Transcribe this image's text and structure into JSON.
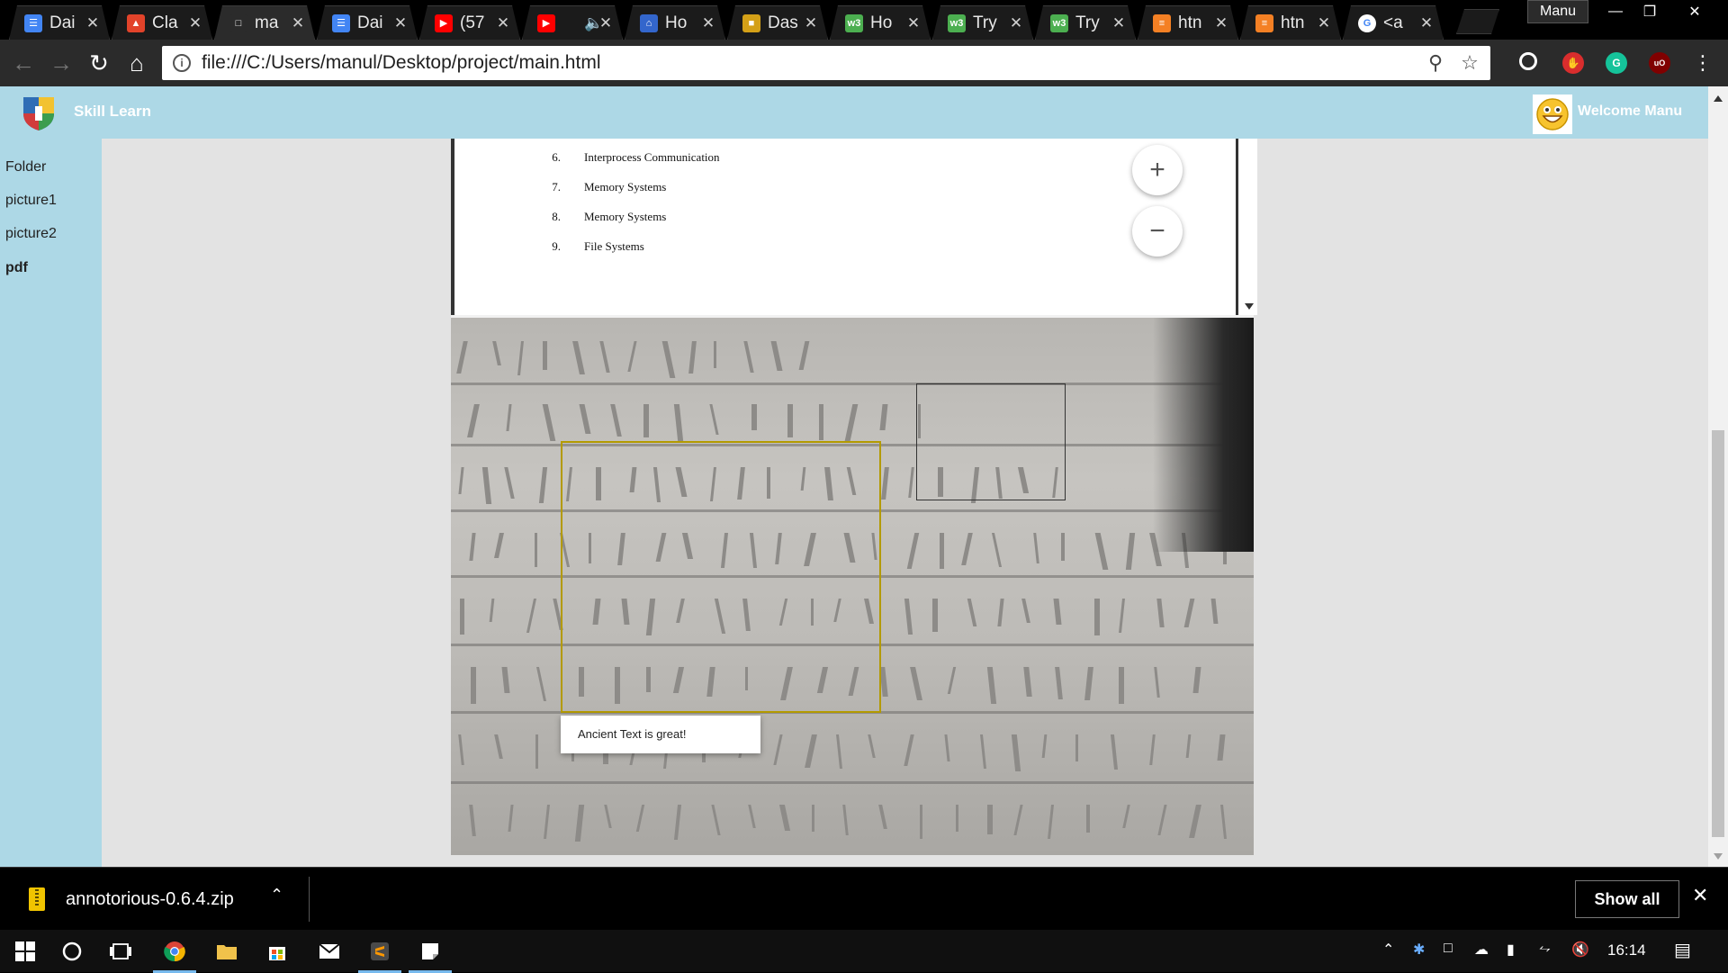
{
  "browser": {
    "tabs": [
      {
        "title": "Dai",
        "favicon": "docs-icon",
        "color": "#4285f4"
      },
      {
        "title": "Cla",
        "favicon": "gitlab-icon",
        "color": "#e2432a"
      },
      {
        "title": "ma",
        "favicon": "page-icon",
        "color": "#2b2b2b",
        "active": true
      },
      {
        "title": "Dai",
        "favicon": "docs-icon",
        "color": "#4285f4"
      },
      {
        "title": "(57",
        "favicon": "youtube-icon",
        "color": "#ff0000"
      },
      {
        "title": "",
        "favicon": "youtube-icon",
        "color": "#ff0000",
        "muted": true
      },
      {
        "title": "Ho",
        "favicon": "institution-icon",
        "color": "#3366cc"
      },
      {
        "title": "Das",
        "favicon": "dashboard-icon",
        "color": "#d4a017"
      },
      {
        "title": "Ho",
        "favicon": "w3schools-icon",
        "color": "#4caf50"
      },
      {
        "title": "Try",
        "favicon": "w3schools-icon",
        "color": "#4caf50"
      },
      {
        "title": "Try",
        "favicon": "w3schools-icon",
        "color": "#4caf50"
      },
      {
        "title": "htn",
        "favicon": "stackoverflow-icon",
        "color": "#f48024"
      },
      {
        "title": "htn",
        "favicon": "stackoverflow-icon",
        "color": "#f48024"
      },
      {
        "title": "<a",
        "favicon": "google-icon",
        "color": "#ffffff"
      }
    ],
    "profile_name": "Manu",
    "url": "file:///C:/Users/manul/Desktop/project/main.html"
  },
  "app": {
    "brand": "Skill Learn",
    "welcome": "Welcome Manu",
    "sidebar": [
      {
        "label": "Folder",
        "bold": false
      },
      {
        "label": "picture1",
        "bold": false
      },
      {
        "label": "picture2",
        "bold": false
      },
      {
        "label": "pdf",
        "bold": true
      }
    ],
    "pdf_rows": [
      {
        "num": "6.",
        "text": "Interprocess Communication"
      },
      {
        "num": "7.",
        "text": "Memory Systems"
      },
      {
        "num": "8.",
        "text": "Memory Systems"
      },
      {
        "num": "9.",
        "text": "File Systems"
      }
    ],
    "zoom_in": "+",
    "zoom_out": "−",
    "annotation_text": "Ancient Text is great!"
  },
  "downloads": {
    "filename": "annotorious-0.6.4.zip",
    "show_all": "Show all"
  },
  "taskbar": {
    "time": "16:14"
  }
}
